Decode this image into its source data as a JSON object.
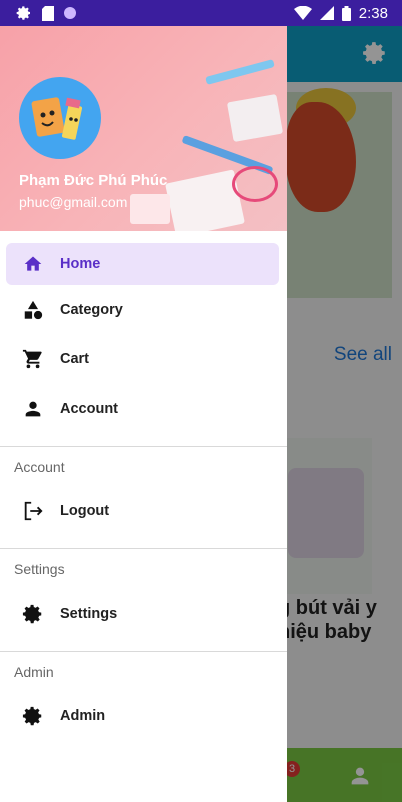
{
  "status_bar": {
    "time": "2:38"
  },
  "background": {
    "see_all": "See all",
    "product_name": "g bút vải y hiệu baby",
    "cart_badge": "3"
  },
  "drawer": {
    "user": {
      "name": "Phạm Đức Phú Phúc",
      "email": "phuc@gmail.com"
    },
    "items": [
      {
        "label": "Home",
        "icon": "home-icon",
        "active": true
      },
      {
        "label": "Category",
        "icon": "category-icon"
      },
      {
        "label": "Cart",
        "icon": "cart-icon"
      },
      {
        "label": "Account",
        "icon": "account-icon"
      }
    ],
    "sections": [
      {
        "title": "Account",
        "item": {
          "label": "Logout",
          "icon": "logout-icon"
        }
      },
      {
        "title": "Settings",
        "item": {
          "label": "Settings",
          "icon": "gear-icon"
        }
      },
      {
        "title": "Admin",
        "item": {
          "label": "Admin",
          "icon": "gear-icon"
        }
      }
    ]
  },
  "colors": {
    "accent": "#5a2fc7",
    "active_bg": "#ece2fb",
    "status_bar": "#3b1e9e",
    "app_bar": "#0e9fc7",
    "bottom_nav": "#7ac943"
  }
}
